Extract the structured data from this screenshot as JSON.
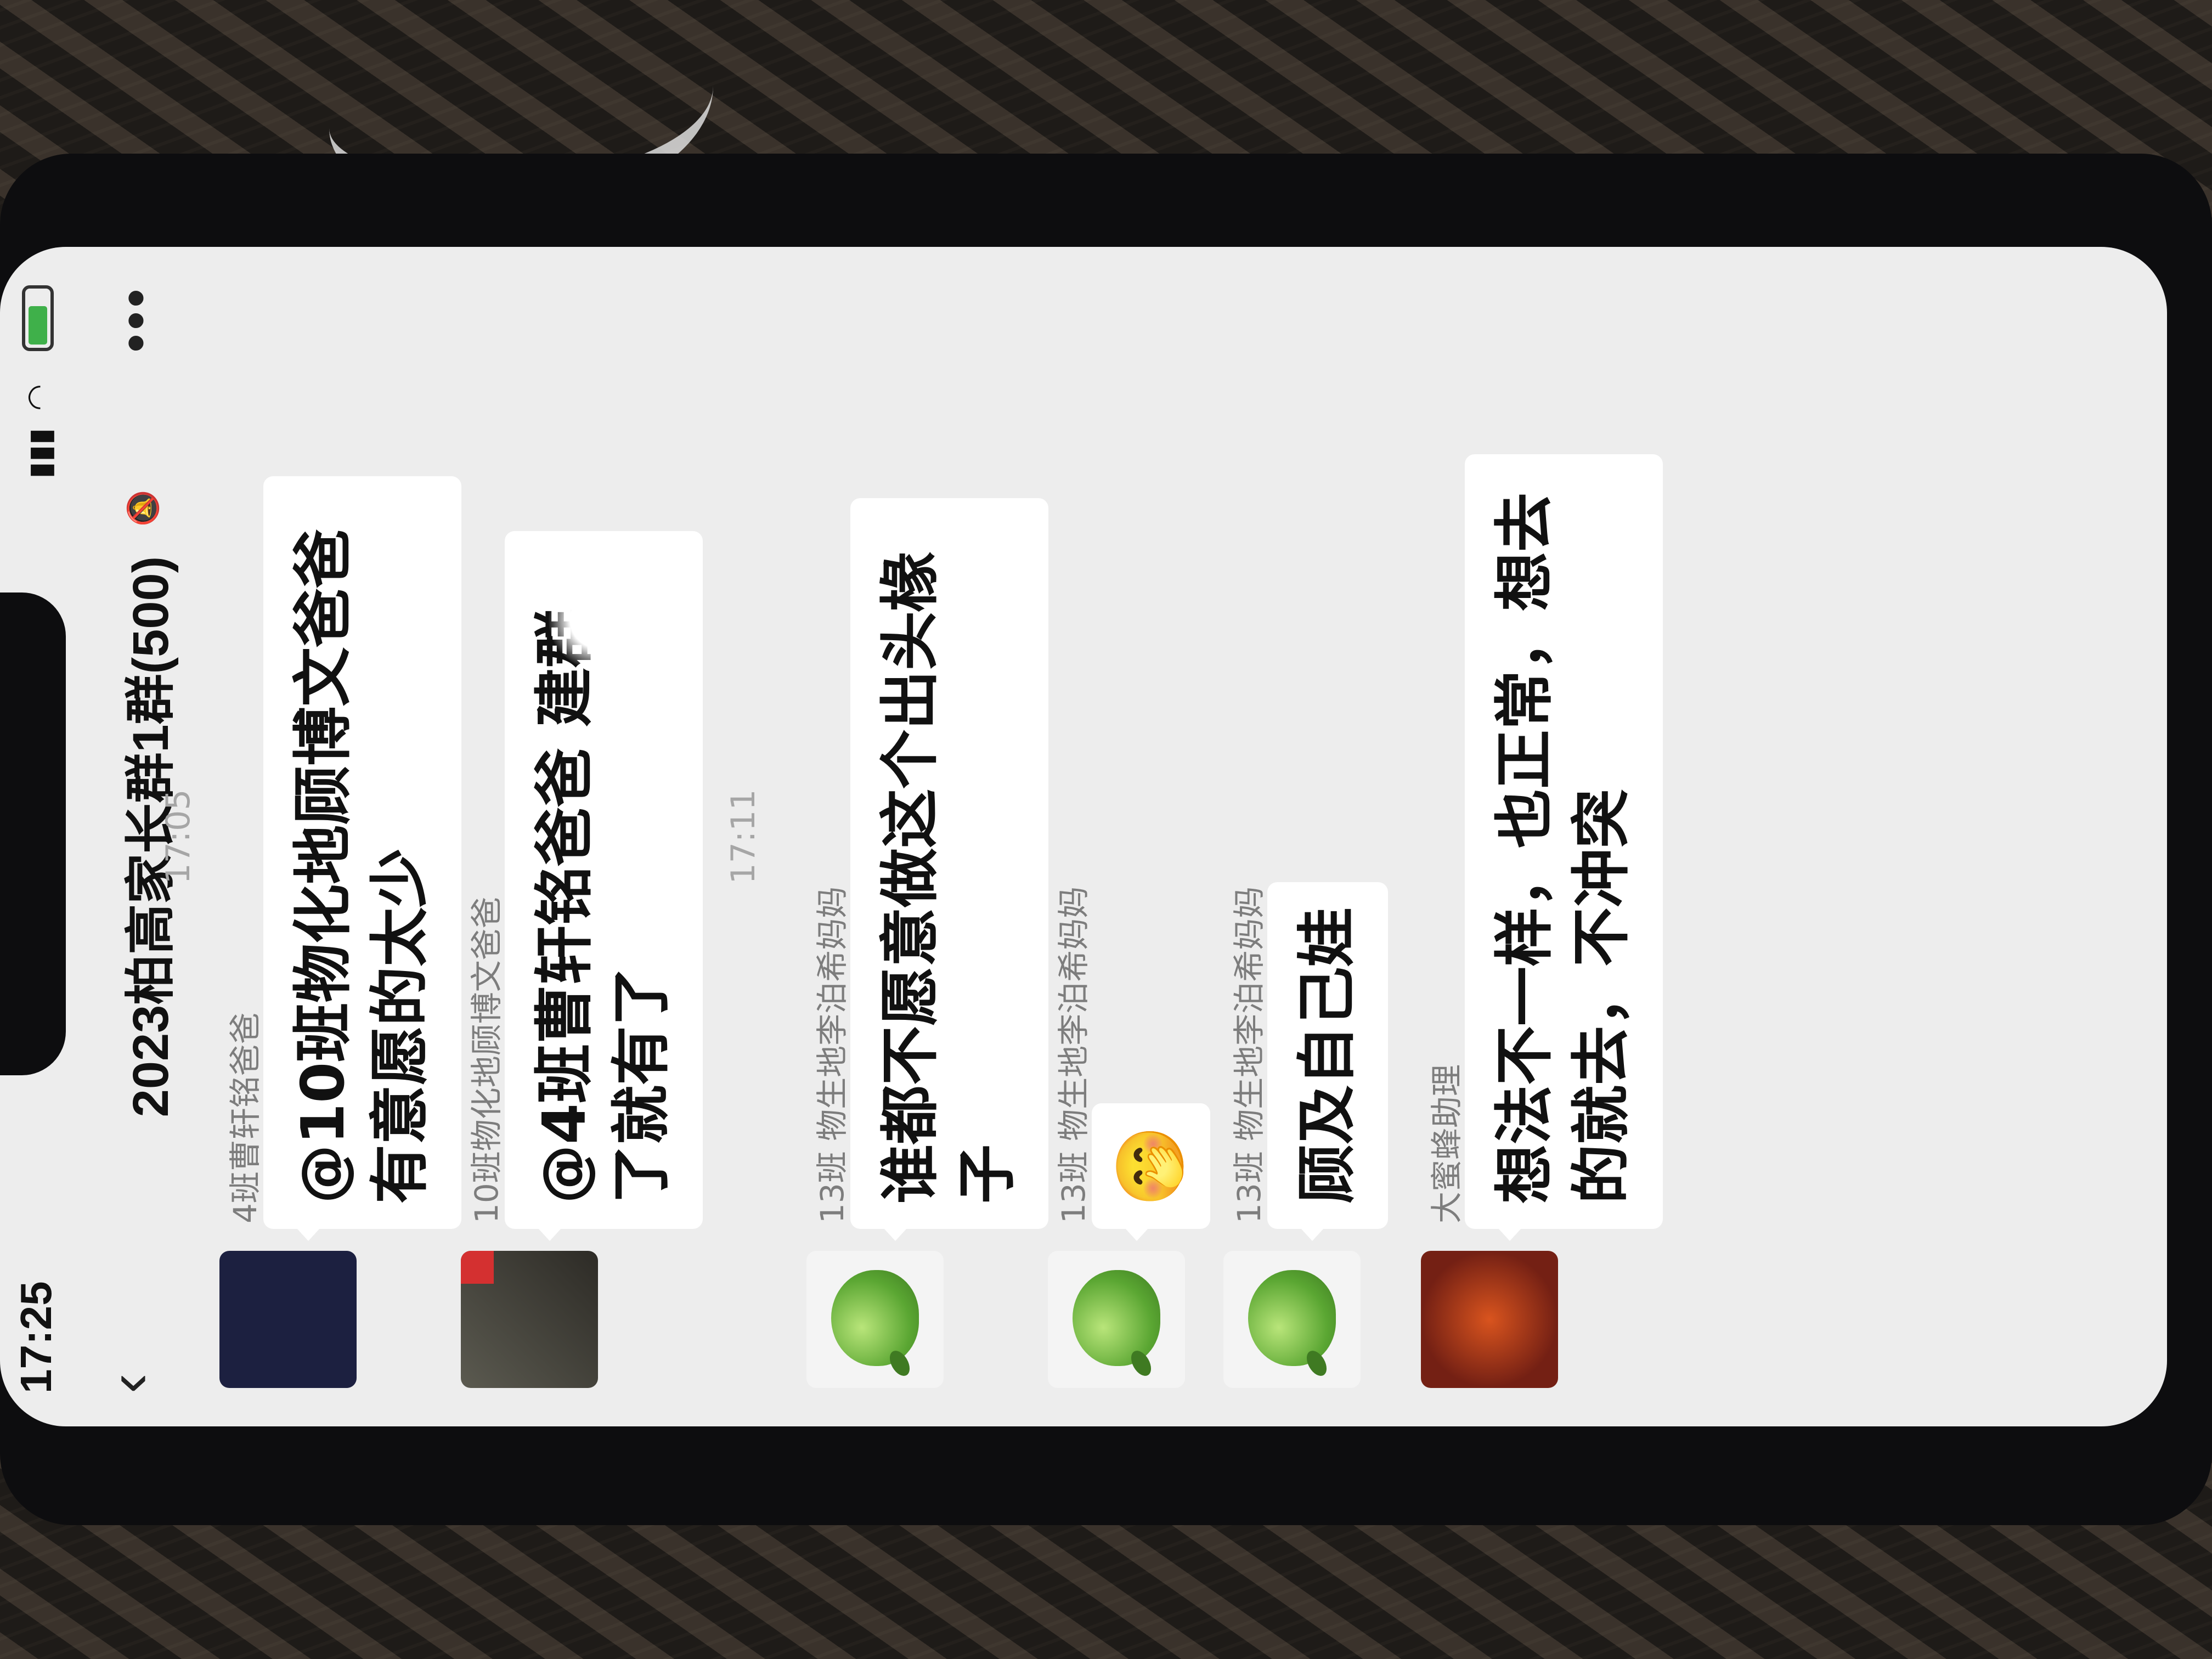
{
  "status_bar": {
    "time": "17:25",
    "signal_icon": "signal-bars-icon",
    "wifi_icon": "wifi-icon",
    "battery_icon": "battery-charging-icon"
  },
  "header": {
    "title": "2023柏高家长群1群(500)",
    "back_icon": "chevron-left-icon",
    "mute_icon": "muted-bell-icon",
    "more_icon": "more-dots-icon"
  },
  "timestamps": [
    "17:05",
    "17:11"
  ],
  "messages": [
    {
      "sender": "4班曹轩铭爸爸",
      "text": "@10班物化地顾博文爸爸 有意愿的太少",
      "avatar": "dark-avatar"
    },
    {
      "sender": "10班物化地顾博文爸爸",
      "text": "@4班曹轩铭爸爸 建群了就有了",
      "avatar": "photo-avatar"
    },
    {
      "sender": "13班 物生地李泊希妈妈",
      "text": "谁都不愿意做这个出头椽子",
      "avatar": "green-apple-avatar"
    },
    {
      "sender": "13班 物生地李泊希妈妈",
      "text": "🤭",
      "avatar": "green-apple-avatar"
    },
    {
      "sender": "13班 物生地李泊希妈妈",
      "text": "顾及自己娃",
      "avatar": "green-apple-avatar"
    },
    {
      "sender": "大蜜蜂助理",
      "text": "想法不一样，也正常，想去的就去，不冲突",
      "avatar": "clownfish-avatar"
    }
  ]
}
